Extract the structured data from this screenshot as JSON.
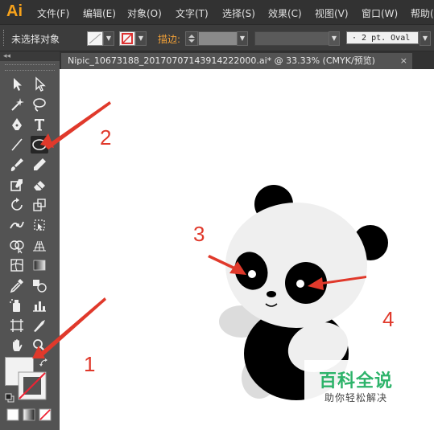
{
  "app": {
    "logo": "Ai"
  },
  "menu": [
    {
      "label": "文件(F)"
    },
    {
      "label": "编辑(E)"
    },
    {
      "label": "对象(O)"
    },
    {
      "label": "文字(T)"
    },
    {
      "label": "选择(S)"
    },
    {
      "label": "效果(C)"
    },
    {
      "label": "视图(V)"
    },
    {
      "label": "窗口(W)"
    },
    {
      "label": "帮助("
    }
  ],
  "control_bar": {
    "selection_status": "未选择对象",
    "stroke_label": "描边:",
    "brush_value": "· 2 pt. Oval"
  },
  "document_tab": {
    "title": "Nipic_10673188_20170707143914222000.ai* @ 33.33% (CMYK/预览)",
    "close": "×"
  },
  "toolbar": {
    "header": "◂◂"
  },
  "annotations": [
    "1",
    "2",
    "3",
    "4"
  ],
  "watermark": {
    "title": "百科全说",
    "subtitle": "助你轻松解决"
  },
  "colors": {
    "menubar": "#323232",
    "panel": "#535353",
    "accent_logo": "#f7a21b",
    "annotation_red": "#e0392b",
    "watermark_green": "#2db36a"
  }
}
